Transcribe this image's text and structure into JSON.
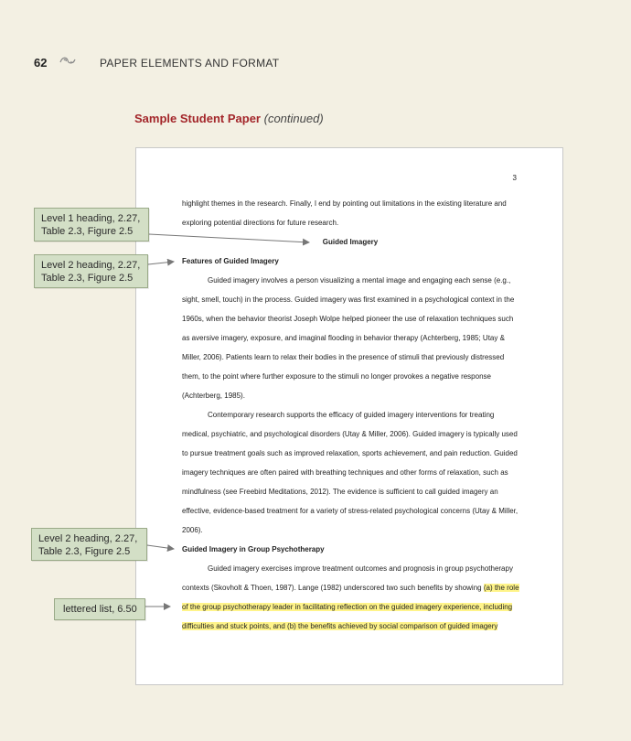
{
  "header": {
    "page_number": "62",
    "section_title": "PAPER ELEMENTS AND FORMAT"
  },
  "sample": {
    "title": "Sample Student Paper",
    "continued": "(continued)"
  },
  "paper": {
    "page_number": "3",
    "lines": [
      "highlight themes in the research. Finally, I end by pointing out limitations in the existing literature and",
      "exploring potential directions for future research.",
      "Guided Imagery",
      "Features of Guided Imagery",
      "Guided imagery involves a person visualizing a mental image and engaging each sense (e.g.,",
      "sight, smell, touch) in the process. Guided imagery was first examined in a psychological context in the",
      "1960s, when the behavior theorist Joseph Wolpe helped pioneer the use of relaxation techniques such",
      "as aversive imagery, exposure, and imaginal flooding in behavior therapy (Achterberg, 1985; Utay &",
      "Miller, 2006). Patients learn to relax their bodies in the presence of stimuli that previously distressed",
      "them, to the point where further exposure to the stimuli no longer provokes a negative response",
      "(Achterberg, 1985).",
      "Contemporary research supports the efficacy of guided imagery interventions for treating",
      "medical, psychiatric, and psychological disorders (Utay & Miller, 2006). Guided imagery is typically used",
      "to pursue treatment goals such as improved relaxation, sports achievement, and pain reduction. Guided",
      "imagery techniques are often paired with breathing techniques and other forms of relaxation, such as",
      "mindfulness (see Freebird Meditations, 2012). The evidence is sufficient to call guided imagery an",
      "effective, evidence-based treatment for a variety of stress-related psychological concerns (Utay & Miller,",
      "2006).",
      "Guided Imagery in Group Psychotherapy",
      "Guided imagery exercises improve treatment outcomes and prognosis in group psychotherapy",
      "contexts (Skovholt & Thoen, 1987). Lange (1982) underscored two such benefits by showing ",
      "(a) the role",
      "of the group psychotherapy leader in facilitating reflection on the guided imagery experience, including",
      "difficulties and stuck points, and (b) the benefits achieved by social comparison of guided imagery"
    ]
  },
  "callouts": {
    "level1": "Level 1 heading, 2.27, Table 2.3, Figure 2.5",
    "level1_a": "Level 1 heading, 2.27,",
    "level1_b": "Table 2.3, Figure 2.5",
    "level2a_a": "Level 2 heading, 2.27,",
    "level2a_b": "Table 2.3, Figure 2.5",
    "level2b_a": "Level 2 heading, 2.27,",
    "level2b_b": "Table 2.3, Figure 2.5",
    "lettered": "lettered list, 6.50"
  },
  "colors": {
    "accent_red": "#a3262a",
    "callout_bg": "#d3dfc6",
    "highlight": "#fff48a"
  },
  "icons": {
    "ornament": "ornament-icon"
  }
}
